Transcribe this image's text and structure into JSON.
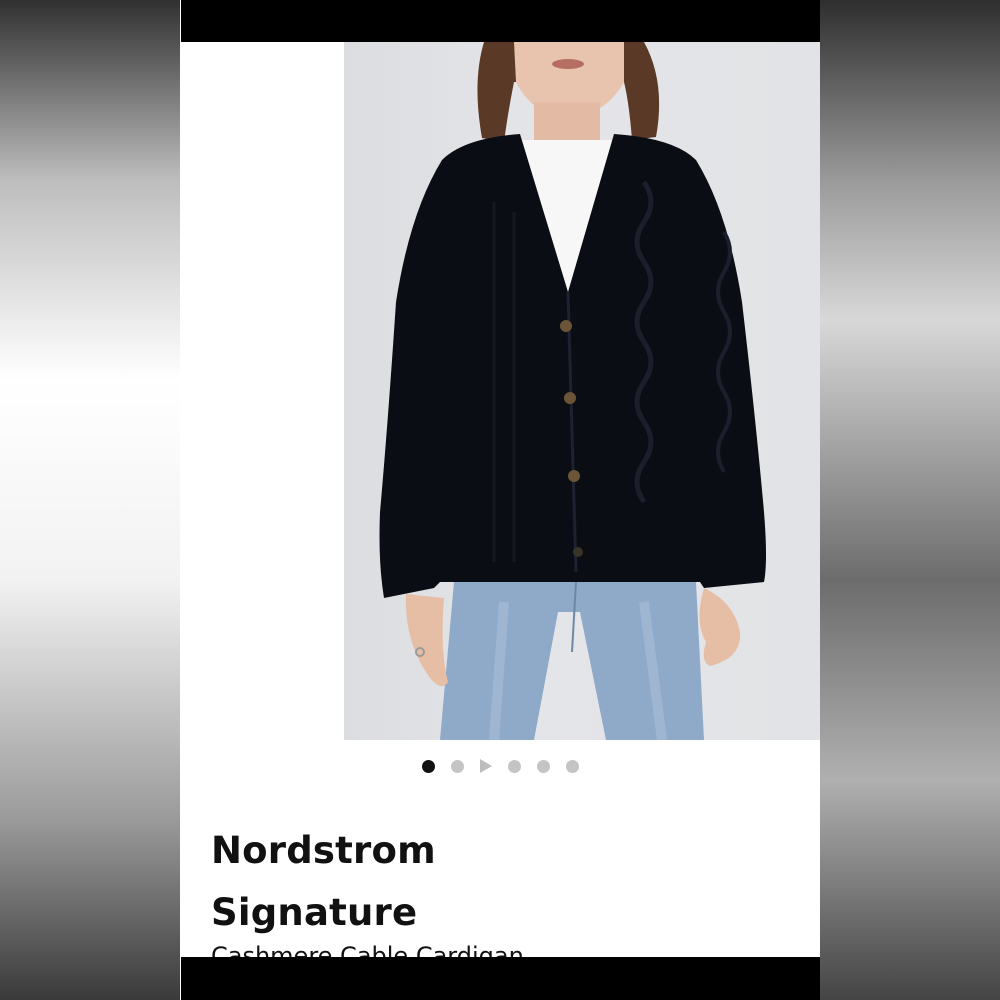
{
  "product": {
    "brand": "Nordstrom Signature",
    "name": "Cashmere Cable Cardigan"
  },
  "gallery": {
    "slides": [
      "image",
      "image",
      "video",
      "image",
      "image",
      "image"
    ],
    "active_index": 0
  },
  "colors": {
    "frame_bars": "#000000",
    "photo_background": "#e0e1e4",
    "active_dot": "#111111",
    "inactive_dot": "#c4c4c4"
  },
  "icons": {
    "video_slide": "play-icon"
  }
}
